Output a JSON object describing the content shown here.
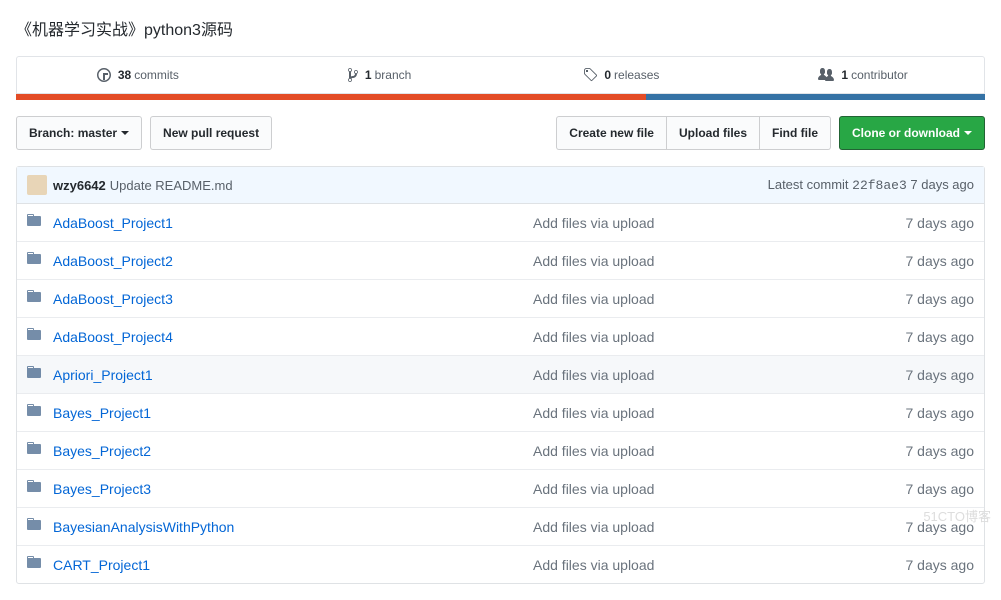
{
  "repo_title": "《机器学习实战》python3源码",
  "stats": {
    "commits": {
      "count": "38",
      "label": "commits"
    },
    "branches": {
      "count": "1",
      "label": "branch"
    },
    "releases": {
      "count": "0",
      "label": "releases"
    },
    "contributors": {
      "count": "1",
      "label": "contributor"
    }
  },
  "toolbar": {
    "branch_label": "Branch:",
    "branch_name": "master",
    "new_pr": "New pull request",
    "create_file": "Create new file",
    "upload_files": "Upload files",
    "find_file": "Find file",
    "clone": "Clone or download"
  },
  "commit": {
    "author": "wzy6642",
    "message": "Update README.md",
    "latest_label": "Latest commit",
    "sha": "22f8ae3",
    "age": "7 days ago"
  },
  "files": [
    {
      "name": "AdaBoost_Project1",
      "msg": "Add files via upload",
      "age": "7 days ago",
      "hl": false
    },
    {
      "name": "AdaBoost_Project2",
      "msg": "Add files via upload",
      "age": "7 days ago",
      "hl": false
    },
    {
      "name": "AdaBoost_Project3",
      "msg": "Add files via upload",
      "age": "7 days ago",
      "hl": false
    },
    {
      "name": "AdaBoost_Project4",
      "msg": "Add files via upload",
      "age": "7 days ago",
      "hl": false
    },
    {
      "name": "Apriori_Project1",
      "msg": "Add files via upload",
      "age": "7 days ago",
      "hl": true
    },
    {
      "name": "Bayes_Project1",
      "msg": "Add files via upload",
      "age": "7 days ago",
      "hl": false
    },
    {
      "name": "Bayes_Project2",
      "msg": "Add files via upload",
      "age": "7 days ago",
      "hl": false
    },
    {
      "name": "Bayes_Project3",
      "msg": "Add files via upload",
      "age": "7 days ago",
      "hl": false
    },
    {
      "name": "BayesianAnalysisWithPython",
      "msg": "Add files via upload",
      "age": "7 days ago",
      "hl": false
    },
    {
      "name": "CART_Project1",
      "msg": "Add files via upload",
      "age": "7 days ago",
      "hl": false
    }
  ],
  "watermark": "51CTO博客"
}
